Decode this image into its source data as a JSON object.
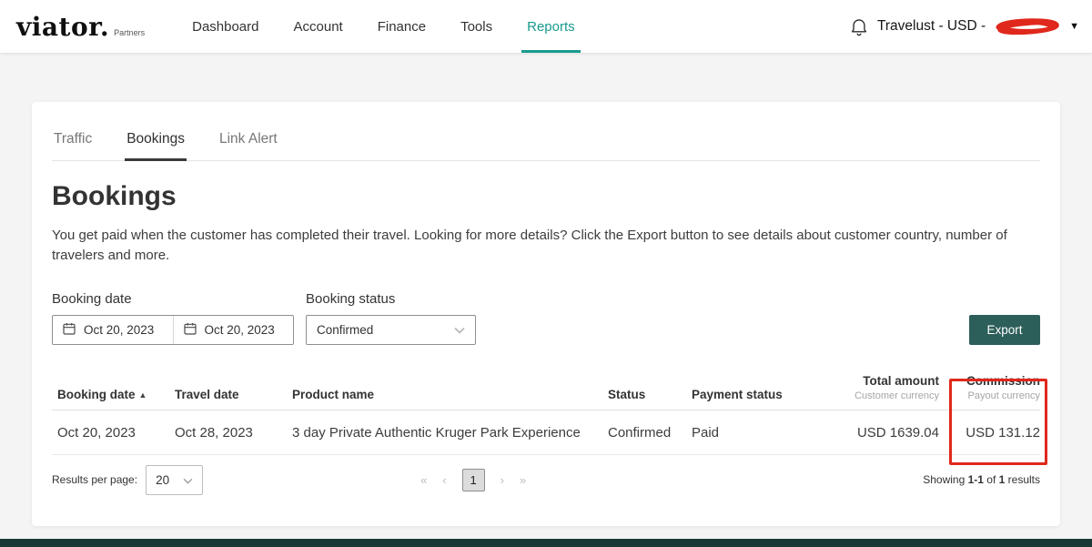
{
  "colors": {
    "accent_teal": "#189a8e",
    "export_button": "#2d5f5a",
    "annotation_red": "#e0281c",
    "footer_bar": "#1b3a35"
  },
  "header": {
    "logo_main": "viator.",
    "logo_sub": "Partners",
    "nav": [
      {
        "label": "Dashboard",
        "active": false
      },
      {
        "label": "Account",
        "active": false
      },
      {
        "label": "Finance",
        "active": false
      },
      {
        "label": "Tools",
        "active": false
      },
      {
        "label": "Reports",
        "active": true
      }
    ],
    "account_label": "Travelust - USD -",
    "icons": {
      "bell": "bell-icon",
      "caret": "▼"
    }
  },
  "tabs": [
    {
      "label": "Traffic",
      "active": false
    },
    {
      "label": "Bookings",
      "active": true
    },
    {
      "label": "Link Alert",
      "active": false
    }
  ],
  "page": {
    "title": "Bookings",
    "description": "You get paid when the customer has completed their travel. Looking for more details? Click the Export button to see details about customer country, number of travelers and more."
  },
  "filters": {
    "booking_date_label": "Booking date",
    "date_from": "Oct 20, 2023",
    "date_to": "Oct 20, 2023",
    "booking_status_label": "Booking status",
    "booking_status_value": "Confirmed",
    "export_label": "Export"
  },
  "table": {
    "sort_icon": "▲",
    "columns": [
      {
        "label": "Booking date",
        "sub": "",
        "sorted_asc": true
      },
      {
        "label": "Travel date",
        "sub": ""
      },
      {
        "label": "Product name",
        "sub": ""
      },
      {
        "label": "Status",
        "sub": ""
      },
      {
        "label": "Payment status",
        "sub": ""
      },
      {
        "label": "Total amount",
        "sub": "Customer currency"
      },
      {
        "label": "Commission",
        "sub": "Payout currency"
      }
    ],
    "rows": [
      [
        "Oct 20, 2023",
        "Oct 28, 2023",
        "3 day Private Authentic Kruger Park Experience",
        "Confirmed",
        "Paid",
        "USD 1639.04",
        "USD 131.12"
      ]
    ]
  },
  "footer": {
    "results_per_page_label": "Results per page:",
    "results_per_page_value": "20",
    "pagination_icons": {
      "first": "«",
      "prev": "‹",
      "next": "›",
      "last": "»"
    },
    "current_page": "1",
    "showing": [
      "Showing ",
      "1-1",
      " of ",
      "1",
      " results"
    ]
  }
}
